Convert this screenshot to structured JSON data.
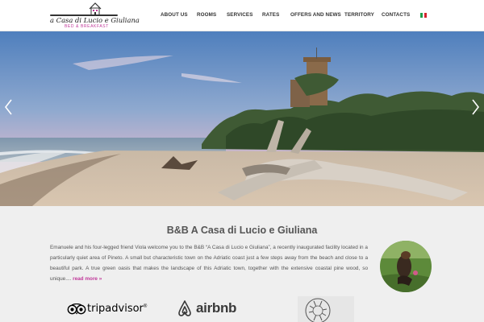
{
  "brand": {
    "name": "a Casa di Lucio e Giuliana",
    "subtitle": "BED & BREAKFAST",
    "logo_icon": "house-icon",
    "accent_color": "#c0399a"
  },
  "nav": {
    "items": [
      {
        "label": "ABOUT US"
      },
      {
        "label": "ROOMS"
      },
      {
        "label": "SERVICES"
      },
      {
        "label": "RATES"
      },
      {
        "label": "OFFERS AND NEWS"
      },
      {
        "label": "TERRITORY"
      },
      {
        "label": "CONTACTS"
      }
    ],
    "language_icon": "italian-flag-icon"
  },
  "hero": {
    "prev_icon": "chevron-left-icon",
    "next_icon": "chevron-right-icon"
  },
  "intro": {
    "title": "B&B A Casa di Lucio e Giuliana",
    "text": "Emanuele and his four-legged friend Viola welcome you to the B&B “A Casa di Lucio e Giuliana”, a recently inaugurated facility located in a particularly quiet area of Pineto. A small but characteristic town on the Adriatic coast just a few steps away from the beach and close to a beautiful park. A true green oasis that makes the landscape of this Adriatic town, together with the extensive coastal pine wood, so unique.... ",
    "read_more": "read more »"
  },
  "partners": {
    "tripadvisor": "tripadvisor",
    "tripadvisor_mark": "®",
    "airbnb": "airbnb",
    "seal_icon": "seal-icon"
  }
}
